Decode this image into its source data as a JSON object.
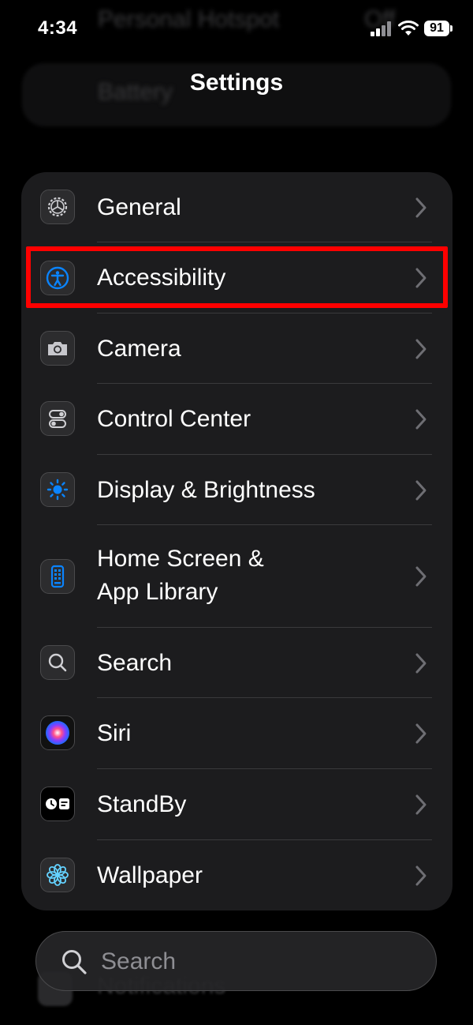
{
  "status": {
    "time": "4:34",
    "battery": "91"
  },
  "background_rows": {
    "hotspot_label": "Personal Hotspot",
    "hotspot_value": "Off",
    "battery_label": "Battery",
    "notifications_label": "Notifications"
  },
  "header": {
    "title": "Settings"
  },
  "settings": {
    "items": [
      {
        "label": "General",
        "icon": "gear-icon"
      },
      {
        "label": "Accessibility",
        "icon": "accessibility-icon"
      },
      {
        "label": "Camera",
        "icon": "camera-icon"
      },
      {
        "label": "Control Center",
        "icon": "control-center-icon"
      },
      {
        "label": "Display & Brightness",
        "icon": "sun-icon"
      },
      {
        "label_line1": "Home Screen &",
        "label_line2": "App Library",
        "icon": "home-screen-icon"
      },
      {
        "label": "Search",
        "icon": "search-icon"
      },
      {
        "label": "Siri",
        "icon": "siri-icon"
      },
      {
        "label": "StandBy",
        "icon": "standby-icon"
      },
      {
        "label": "Wallpaper",
        "icon": "wallpaper-icon"
      }
    ]
  },
  "search": {
    "placeholder": "Search"
  },
  "colors": {
    "accent": "#0a84ff",
    "highlight": "#ff0000",
    "card": "#1c1c1e"
  }
}
